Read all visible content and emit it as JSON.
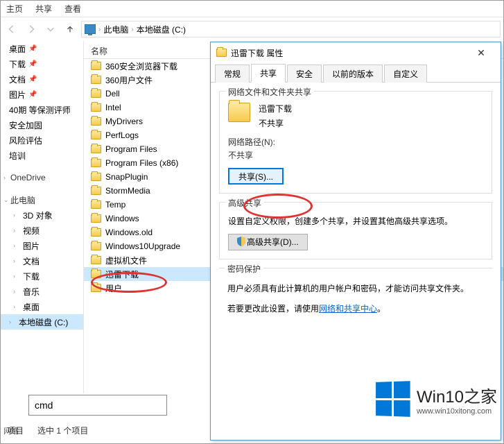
{
  "menubar": {
    "home": "主页",
    "share": "共享",
    "view": "查看"
  },
  "breadcrumb": {
    "pc": "此电脑",
    "disk": "本地磁盘 (C:)"
  },
  "sidebar": {
    "items": [
      {
        "label": "桌面",
        "pinned": true
      },
      {
        "label": "下载",
        "pinned": true
      },
      {
        "label": "文档",
        "pinned": true
      },
      {
        "label": "图片",
        "pinned": true
      },
      {
        "label": "40期 等保测评师"
      },
      {
        "label": "安全加固"
      },
      {
        "label": "风险评估"
      },
      {
        "label": "培训"
      }
    ],
    "groups": [
      {
        "label": "OneDrive"
      },
      {
        "label": "此电脑"
      }
    ],
    "sub": [
      {
        "label": "3D 对象"
      },
      {
        "label": "视频"
      },
      {
        "label": "图片"
      },
      {
        "label": "文档"
      },
      {
        "label": "下载"
      },
      {
        "label": "音乐"
      },
      {
        "label": "桌面"
      }
    ],
    "disk": "本地磁盘 (C:)"
  },
  "filelist": {
    "col_name": "名称",
    "items": [
      "360安全浏览器下载",
      "360用户文件",
      "Dell",
      "Intel",
      "MyDrivers",
      "PerfLogs",
      "Program Files",
      "Program Files (x86)",
      "SnapPlugin",
      "StormMedia",
      "Temp",
      "Windows",
      "Windows.old",
      "Windows10Upgrade",
      "虚拟机文件",
      "迅雷下载",
      "用户"
    ],
    "selected_index": 15
  },
  "status": {
    "left": "项目",
    "right": "选中 1 个项目",
    "net": "网络"
  },
  "dialog": {
    "title": "迅雷下载 属性",
    "tabs": [
      "常规",
      "共享",
      "安全",
      "以前的版本",
      "自定义"
    ],
    "active_tab": 1,
    "section1": {
      "title": "网络文件和文件夹共享",
      "name": "迅雷下载",
      "state": "不共享",
      "path_label": "网络路径(N):",
      "path_val": "不共享",
      "btn": "共享(S)..."
    },
    "section2": {
      "title": "高级共享",
      "desc": "设置自定义权限，创建多个共享，并设置其他高级共享选项。",
      "btn": "高级共享(D)..."
    },
    "section3": {
      "title": "密码保护",
      "desc1": "用户必须具有此计算机的用户帐户和密码，才能访问共享文件夹。",
      "desc2a": "若要更改此设置，请使用",
      "link": "网络和共享中心",
      "desc2b": "。"
    }
  },
  "search": {
    "value": "cmd"
  },
  "watermark": {
    "title": "Win10之家",
    "url": "www.win10xitong.com"
  }
}
